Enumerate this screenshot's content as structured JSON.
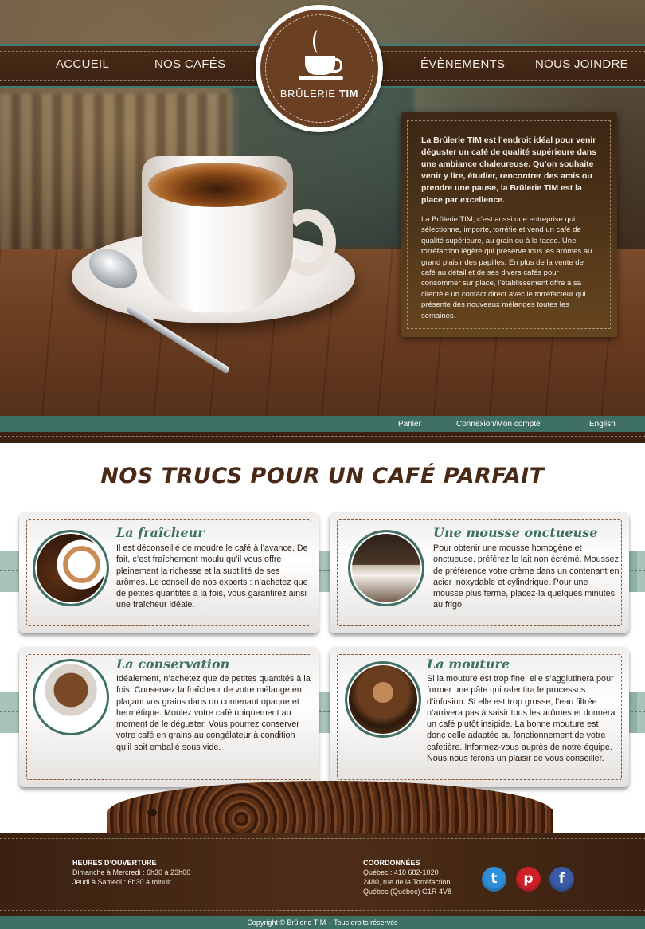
{
  "nav": {
    "left": [
      "ACCUEIL",
      "NOS CAFÉS"
    ],
    "right": [
      "ÉVÈNEMENTS",
      "NOUS JOINDRE"
    ]
  },
  "logo": {
    "brand": "BRÛLERIE",
    "name": "TIM"
  },
  "intro": {
    "lead": "La Brûlerie TIM est l’endroit idéal pour venir déguster un café de qualité supérieure dans une ambiance chaleureuse. Qu’on souhaite venir y lire, étudier, rencontrer des amis ou prendre une pause, la Brûlerie TIM est la place par excellence.",
    "body": "La Brûlerie TIM, c’est aussi une entreprise qui sélectionne, importe, torréfie et vend un café de qualité supérieure, au grain ou à la tasse. Une torréfaction légère qui préserve tous les arômes au grand plaisir des papilles. En plus de la vente de café au détail et de ses divers cafés pour consommer sur place, l’établissement offre à sa clientèle un contact direct avec le torréfacteur qui présente des nouveaux mélanges toutes les semaines."
  },
  "utility": {
    "cart": "Panier",
    "account": "Connexion/Mon compte",
    "language": "English"
  },
  "tips": {
    "title": "NOS TRUCS POUR UN CAFÉ PARFAIT",
    "items": [
      {
        "title": "La fraîcheur",
        "text": "Il est déconseillé de moudre le café à l’avance. De fait, c’est fraîchement moulu qu’il vous offre pleinement la richesse et la subtilité de ses arômes. Le conseil de nos experts : n’achetez que de petites quantités à la fois, vous garantirez ainsi une fraîcheur idéale."
      },
      {
        "title": "Une mousse onctueuse",
        "text": "Pour obtenir une mousse homogène et onctueuse, préférez le lait non écrémé. Moussez de préférence votre crème dans un contenant en acier inoxydable et cylindrique. Pour une mousse plus ferme, placez-la quelques minutes au frigo."
      },
      {
        "title": "La conservation",
        "text": "Idéalement, n’achetez que de petites quantités à la fois. Conservez la fraîcheur de votre mélange en plaçant vos grains dans un contenant opaque et hermétique. Moulez votre café uniquement au moment de le déguster. Vous pourrez conserver votre café en grains au congélateur à condition qu’il soit emballé sous vide."
      },
      {
        "title": "La mouture",
        "text": "Si la mouture est trop fine, elle s’agglutinera pour former une pâte qui ralentira le processus d’infusion. Si elle est trop grosse, l’eau filtrée n’arrivera pas à saisir tous les arômes et donnera un café plutôt insipide. La bonne mouture est donc celle adaptée au fonctionnement de votre cafetière. Informez-vous auprès de notre équipe. Nous nous ferons un plaisir de vous conseiller."
      }
    ]
  },
  "footer": {
    "hours": {
      "title": "HEURES D’OUVERTURE",
      "lines": [
        "Dimanche à Mercredi : 6h30 à 23h00",
        "Jeudi à Samedi : 6h30 à minuit"
      ]
    },
    "contact": {
      "title": "COORDONNÉES",
      "lines": [
        "Québec : 418 682-1020",
        "2480, rue de la Torréfaction",
        "Québec (Québec) G1R 4V8"
      ]
    },
    "social": [
      {
        "name": "twitter-icon",
        "glyph": "t",
        "color": "#2f8fd8"
      },
      {
        "name": "pinterest-icon",
        "glyph": "p",
        "color": "#d0212b"
      },
      {
        "name": "facebook-icon",
        "glyph": "f",
        "color": "#3b5ca8"
      }
    ],
    "copyright": "Copyright © Brûlerie TIM – Tous droits réservés"
  }
}
